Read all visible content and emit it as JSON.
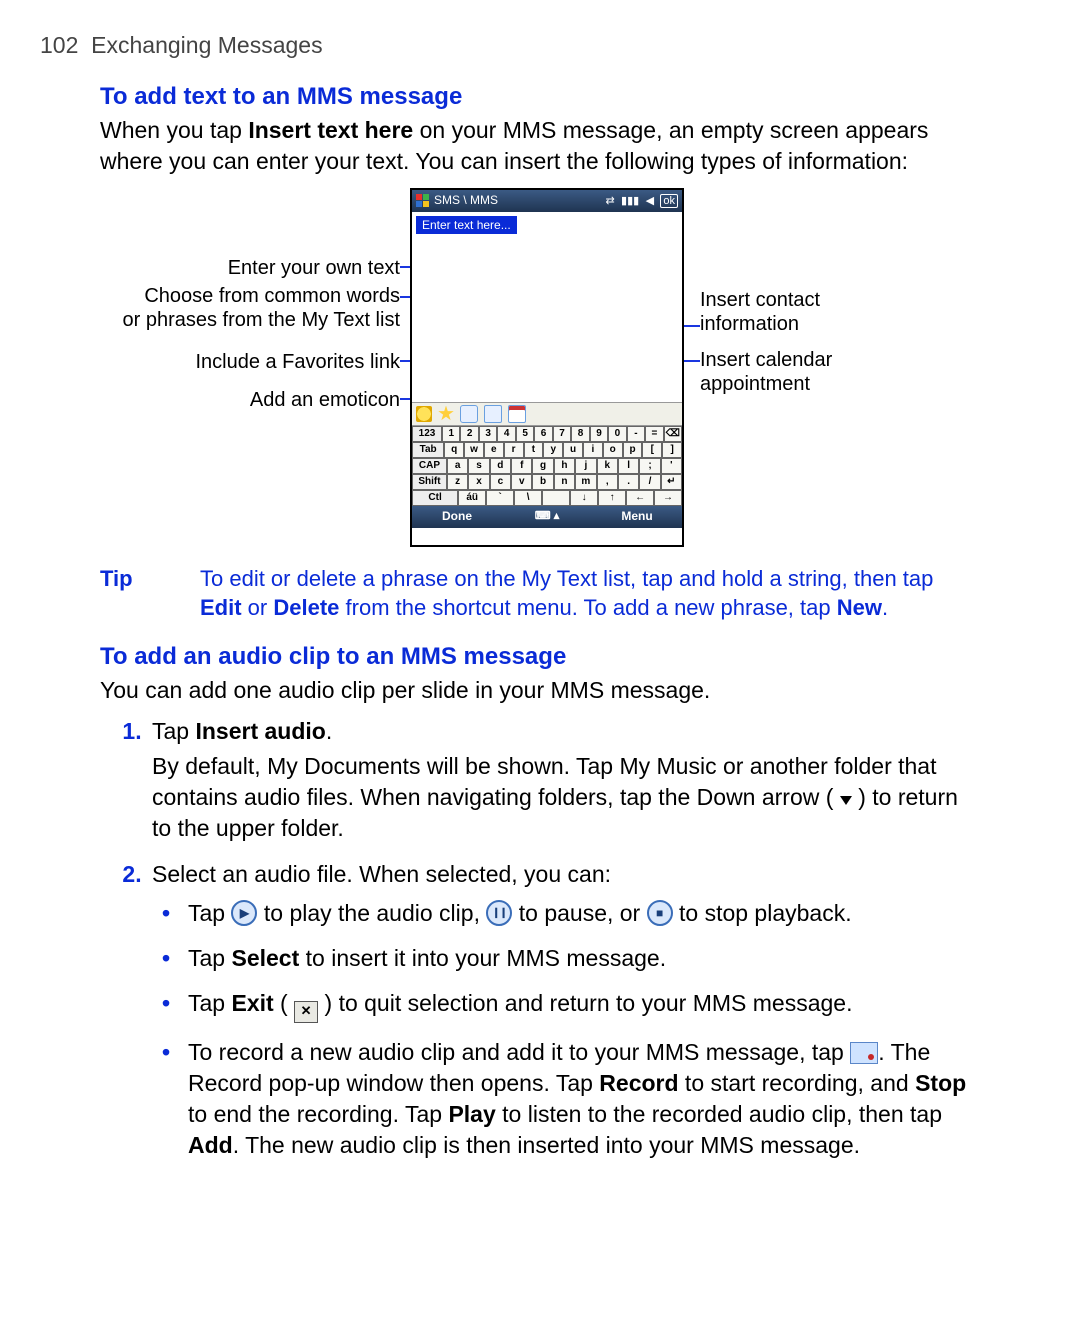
{
  "header": {
    "page_no": "102",
    "chapter": "Exchanging Messages"
  },
  "sec1": {
    "title": "To add text to an MMS message",
    "p1_a": "When you tap ",
    "p1_b": "Insert text here",
    "p1_c": " on your MMS message, an empty screen appears where you can enter your text. You can insert the following types of information:"
  },
  "device": {
    "title": "SMS \\ MMS",
    "ok": "ok",
    "enter_text": "Enter text here...",
    "soft_left": "Done",
    "soft_right": "Menu",
    "kb": {
      "r1": [
        "123",
        "1",
        "2",
        "3",
        "4",
        "5",
        "6",
        "7",
        "8",
        "9",
        "0",
        "-",
        "=",
        "⌫"
      ],
      "r2": [
        "Tab",
        "q",
        "w",
        "e",
        "r",
        "t",
        "y",
        "u",
        "i",
        "o",
        "p",
        "[",
        "]"
      ],
      "r3": [
        "CAP",
        "a",
        "s",
        "d",
        "f",
        "g",
        "h",
        "j",
        "k",
        "l",
        ";",
        "'"
      ],
      "r4": [
        "Shift",
        "z",
        "x",
        "c",
        "v",
        "b",
        "n",
        "m",
        ",",
        ".",
        "/",
        "↵"
      ],
      "r5": [
        "Ctl",
        "áü",
        "`",
        "\\",
        " ",
        "↓",
        "↑",
        "←",
        "→"
      ]
    }
  },
  "callouts": {
    "left": {
      "own": "Enter your own text",
      "mytext1": "Choose from common words",
      "mytext2": "or phrases from the My Text list",
      "fav": "Include a Favorites link",
      "emo": "Add an emoticon"
    },
    "right": {
      "contact1": "Insert contact",
      "contact2": "information",
      "cal1": "Insert calendar",
      "cal2": "appointment"
    }
  },
  "tip": {
    "label": "Tip",
    "t1": "To edit or delete a phrase on the My Text list, tap and hold a string, then tap ",
    "b1": "Edit",
    "t2": " or ",
    "b2": "Delete",
    "t3": " from the shortcut menu. To add a new phrase, tap ",
    "b3": "New",
    "t4": "."
  },
  "sec2": {
    "title": "To add an audio clip to an MMS message",
    "p1": "You can add one audio clip per slide in your MMS message."
  },
  "steps": {
    "s1": {
      "a": "Tap ",
      "b": "Insert audio",
      "c": ".",
      "body": "By default, My Documents will be shown. Tap My Music or another folder that contains audio files. When navigating folders, tap the Down arrow ( ",
      "body2": " ) to return to the upper folder."
    },
    "s2": {
      "a": "Select an audio file. When selected, you can:"
    }
  },
  "bul": {
    "b1": {
      "a": "Tap ",
      "b": " to play the audio clip, ",
      "c": " to pause, or ",
      "d": " to stop playback."
    },
    "b2": {
      "a": "Tap ",
      "b": "Select",
      "c": " to insert it into your MMS message."
    },
    "b3": {
      "a": "Tap ",
      "b": "Exit",
      "c": " ( ",
      "d": " ) to quit selection and return to your MMS message."
    },
    "b4": {
      "a": "To record a new audio clip and add it to your MMS message, tap ",
      "b": ". The Record pop-up window then opens. Tap ",
      "c": "Record",
      "d": " to start recording, and ",
      "e": "Stop",
      "f": " to end the recording. Tap ",
      "g": "Play",
      "h": " to listen to the recorded audio clip, then tap ",
      "i": "Add",
      "j": ". The new audio clip is then inserted into your MMS message."
    }
  }
}
